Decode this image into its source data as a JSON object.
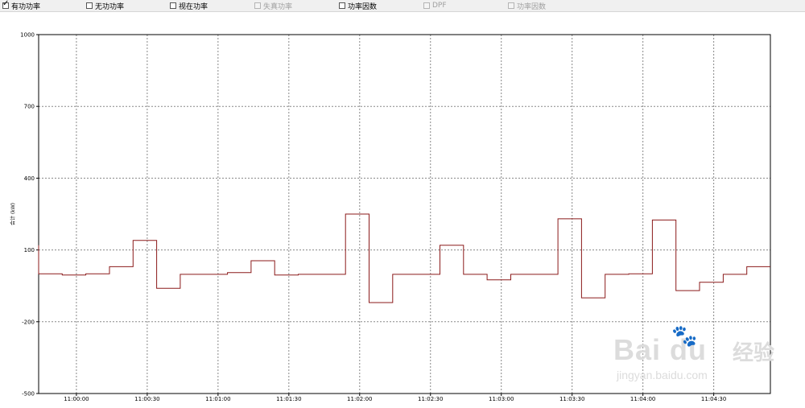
{
  "toolbar": {
    "items": [
      {
        "label": "有功功率",
        "checked": true,
        "enabled": true
      },
      {
        "label": "无功功率",
        "checked": false,
        "enabled": true
      },
      {
        "label": "视在功率",
        "checked": false,
        "enabled": true
      },
      {
        "label": "失真功率",
        "checked": false,
        "enabled": false
      },
      {
        "label": "功率因数",
        "checked": false,
        "enabled": true
      },
      {
        "label": "DPF",
        "checked": false,
        "enabled": false
      },
      {
        "label": "功率因数",
        "checked": false,
        "enabled": false
      }
    ]
  },
  "chart_data": {
    "type": "line",
    "ylabel": "合计 (kW)",
    "ylim": [
      -500,
      1000
    ],
    "yticks": [
      1000,
      700,
      400,
      100,
      -200,
      -500
    ],
    "xlim": [
      "10:59:44",
      "11:04:54"
    ],
    "xticks": [
      "11:00:00",
      "11:00:30",
      "11:01:00",
      "11:01:30",
      "11:02:00",
      "11:02:30",
      "11:03:00",
      "11:03:30",
      "11:04:00",
      "11:04:30"
    ],
    "grid": true,
    "line_color": "#8b1a1a",
    "step": true,
    "series": [
      {
        "points": [
          [
            "10:59:44",
            120
          ],
          [
            "10:59:44",
            0
          ],
          [
            "10:59:54",
            0
          ],
          [
            "10:59:54",
            -5
          ],
          [
            "11:00:04",
            -5
          ],
          [
            "11:00:04",
            0
          ],
          [
            "11:00:14",
            0
          ],
          [
            "11:00:14",
            30
          ],
          [
            "11:00:24",
            30
          ],
          [
            "11:00:24",
            140
          ],
          [
            "11:00:34",
            140
          ],
          [
            "11:00:34",
            -60
          ],
          [
            "11:00:44",
            -60
          ],
          [
            "11:00:44",
            -2
          ],
          [
            "11:01:04",
            -2
          ],
          [
            "11:01:04",
            5
          ],
          [
            "11:01:14",
            5
          ],
          [
            "11:01:14",
            55
          ],
          [
            "11:01:24",
            55
          ],
          [
            "11:01:24",
            -5
          ],
          [
            "11:01:34",
            -5
          ],
          [
            "11:01:34",
            -2
          ],
          [
            "11:01:54",
            -2
          ],
          [
            "11:01:54",
            250
          ],
          [
            "11:02:04",
            250
          ],
          [
            "11:02:04",
            -120
          ],
          [
            "11:02:14",
            -120
          ],
          [
            "11:02:14",
            -2
          ],
          [
            "11:02:34",
            -2
          ],
          [
            "11:02:34",
            120
          ],
          [
            "11:02:44",
            120
          ],
          [
            "11:02:44",
            -2
          ],
          [
            "11:02:54",
            -2
          ],
          [
            "11:02:54",
            -25
          ],
          [
            "11:03:04",
            -25
          ],
          [
            "11:03:04",
            -2
          ],
          [
            "11:03:24",
            -2
          ],
          [
            "11:03:24",
            230
          ],
          [
            "11:03:34",
            230
          ],
          [
            "11:03:34",
            -100
          ],
          [
            "11:03:44",
            -100
          ],
          [
            "11:03:44",
            -2
          ],
          [
            "11:03:54",
            -2
          ],
          [
            "11:03:54",
            0
          ],
          [
            "11:04:04",
            0
          ],
          [
            "11:04:04",
            225
          ],
          [
            "11:04:14",
            225
          ],
          [
            "11:04:14",
            -70
          ],
          [
            "11:04:24",
            -70
          ],
          [
            "11:04:24",
            -35
          ],
          [
            "11:04:34",
            -35
          ],
          [
            "11:04:34",
            -2
          ],
          [
            "11:04:44",
            -2
          ],
          [
            "11:04:44",
            30
          ],
          [
            "11:04:54",
            30
          ]
        ]
      }
    ]
  },
  "watermark": {
    "brand": "Bai du",
    "cn": "经验",
    "url": "jingyan.baidu.com",
    "paw": "🐾"
  }
}
